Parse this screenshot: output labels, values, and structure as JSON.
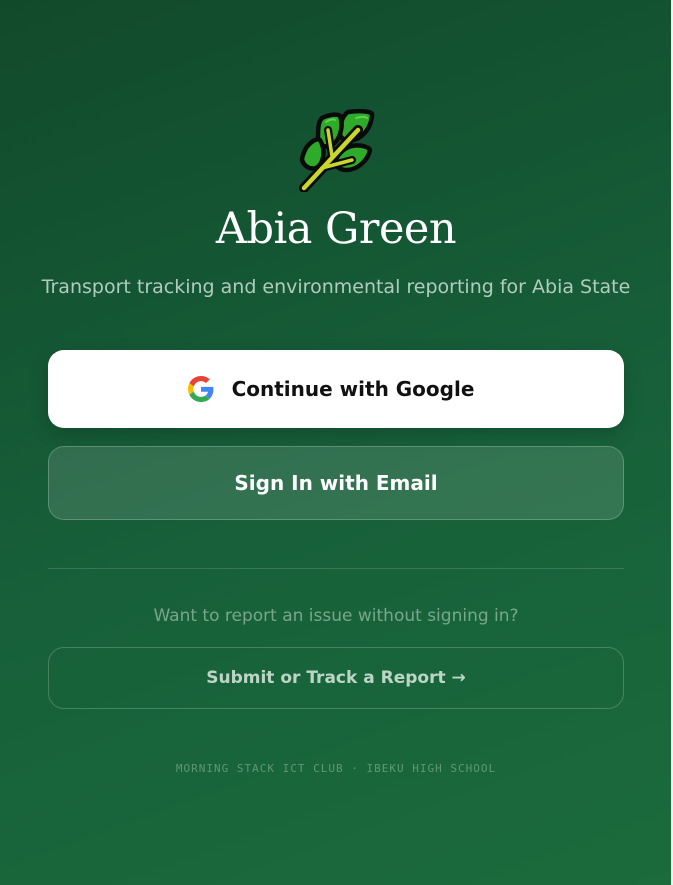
{
  "app": {
    "title": "Abia Green",
    "subtitle": "Transport tracking and environmental reporting for Abia State",
    "logo_icon": "herb-leaf-icon"
  },
  "auth": {
    "google_label": "Continue with Google",
    "google_icon": "google-icon",
    "email_label": "Sign In with Email"
  },
  "report": {
    "prompt": "Want to report an issue without signing in?",
    "button_label": "Submit or Track a Report →"
  },
  "footer": {
    "text": "MORNING STACK ICT CLUB · IBEKU HIGH SCHOOL"
  },
  "colors": {
    "background_top": "#114a2b",
    "background_bottom": "#1b6b3c",
    "leaf_green": "#2eab2a",
    "stem_yellow": "#c9d62b"
  }
}
